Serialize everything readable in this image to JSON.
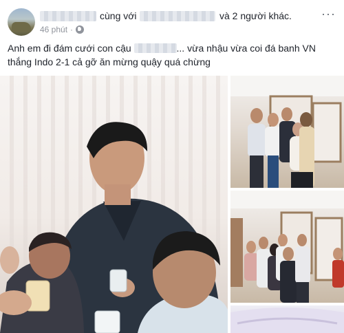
{
  "post": {
    "tagged_prefix": "cùng với",
    "tagged_suffix": "và 2 người khác.",
    "time": "46 phút",
    "more_glyph": "···",
    "caption_part1": "Anh em đi đám cưới con cậu",
    "caption_part2": "... vừa nhậu vừa coi đá banh VN thắng Indo 2-1 cả gỡ ăn mừng quậy quá chừng"
  },
  "icons": {
    "privacy": "globe-icon",
    "menu": "more-options-icon"
  },
  "colors": {
    "text": "#1d2129",
    "meta": "#90949c",
    "shirt_dark": "#2b3440"
  }
}
